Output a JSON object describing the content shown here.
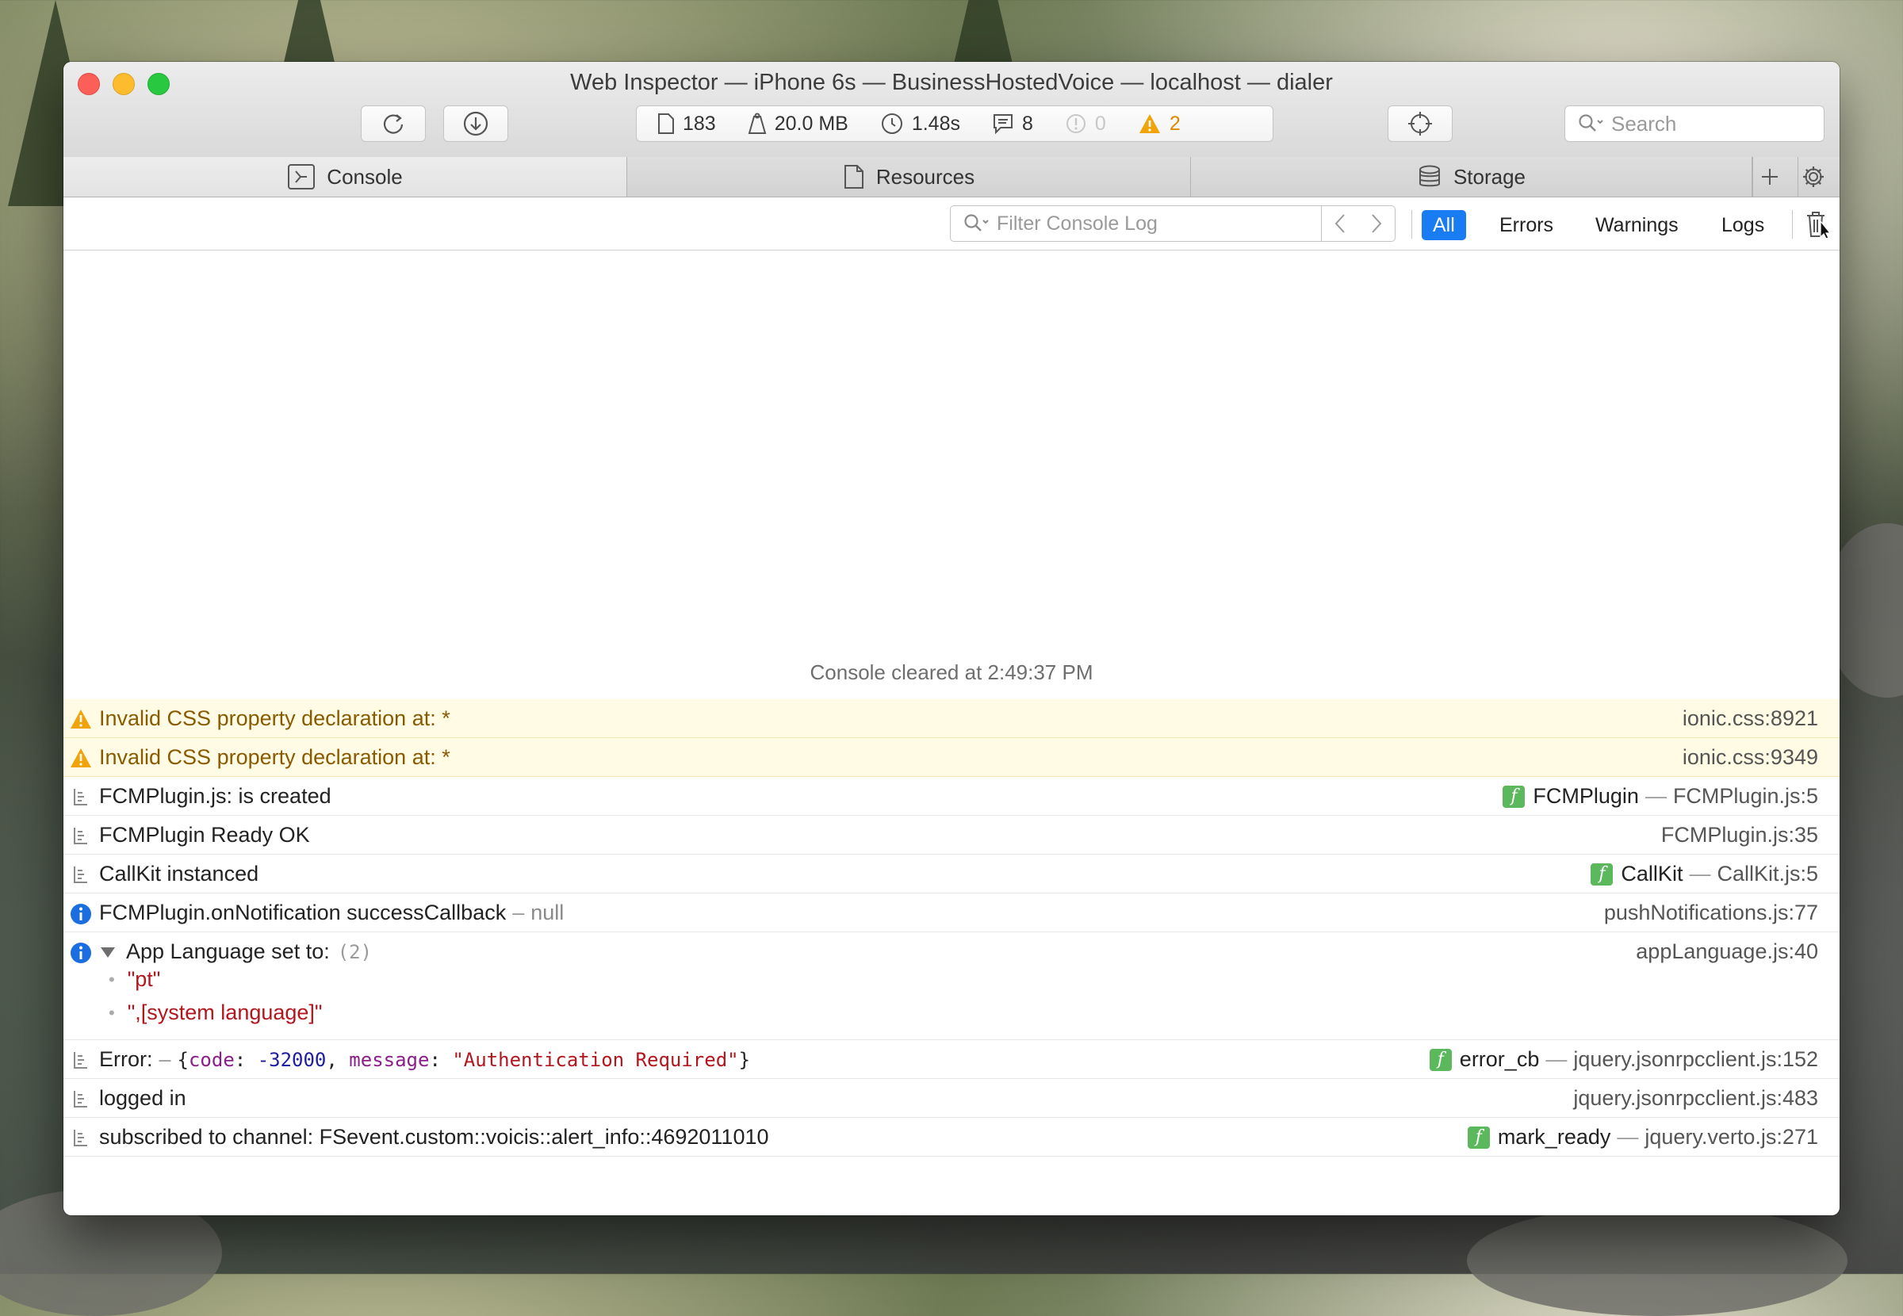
{
  "window": {
    "title": "Web Inspector — iPhone 6s — BusinessHostedVoice — localhost — dialer"
  },
  "toolbar": {
    "reload_icon": "reload-icon",
    "download_icon": "download-icon",
    "resources_count": "183",
    "memory": "20.0 MB",
    "load_time": "1.48s",
    "logs_count": "8",
    "errors_count": "0",
    "warnings_count": "2",
    "target_icon": "crosshair-icon",
    "search_placeholder": "Search"
  },
  "tabs": [
    {
      "label": "Console",
      "icon": "console-icon",
      "active": true
    },
    {
      "label": "Resources",
      "icon": "document-icon",
      "active": false
    },
    {
      "label": "Storage",
      "icon": "database-icon",
      "active": false
    }
  ],
  "filter": {
    "placeholder": "Filter Console Log",
    "levels": [
      "All",
      "Errors",
      "Warnings",
      "Logs"
    ],
    "active_level": "All"
  },
  "console": {
    "cleared_message": "Console cleared at 2:49:37 PM",
    "entries": [
      {
        "type": "warning",
        "message": "Invalid CSS property declaration at: *",
        "source": "ionic.css:8921"
      },
      {
        "type": "warning",
        "message": "Invalid CSS property declaration at: *",
        "source": "ionic.css:9349"
      },
      {
        "type": "log",
        "message": "FCMPlugin.js: is created",
        "function": "FCMPlugin",
        "source": "FCMPlugin.js:5"
      },
      {
        "type": "log",
        "message": "FCMPlugin Ready OK",
        "source": "FCMPlugin.js:35"
      },
      {
        "type": "log",
        "message": "CallKit instanced",
        "function": "CallKit",
        "source": "CallKit.js:5"
      },
      {
        "type": "info",
        "message": "FCMPlugin.onNotification successCallback",
        "extra": "null",
        "source": "pushNotifications.js:77"
      },
      {
        "type": "info",
        "message": "App Language set to:",
        "count": "(2)",
        "items": [
          "\"pt\"",
          "\",[system language]\""
        ],
        "source": "appLanguage.js:40"
      },
      {
        "type": "log",
        "message": "Error:",
        "object": {
          "code_key": "code",
          "code_val": "-32000",
          "msg_key": "message",
          "msg_val": "\"Authentication Required\""
        },
        "function": "error_cb",
        "source": "jquery.jsonrpcclient.js:152"
      },
      {
        "type": "log",
        "message": "logged in",
        "source": "jquery.jsonrpcclient.js:483"
      },
      {
        "type": "log",
        "message": "subscribed to channel: FSevent.custom::voicis::alert_info::4692011010",
        "function": "mark_ready",
        "source": "jquery.verto.js:271"
      }
    ],
    "prompt_symbol": "›"
  },
  "colors": {
    "accent": "#1a7cf2",
    "warning_bg": "#fffbe4",
    "warning_text": "#8a5a00",
    "function_badge": "#5cb85c"
  }
}
